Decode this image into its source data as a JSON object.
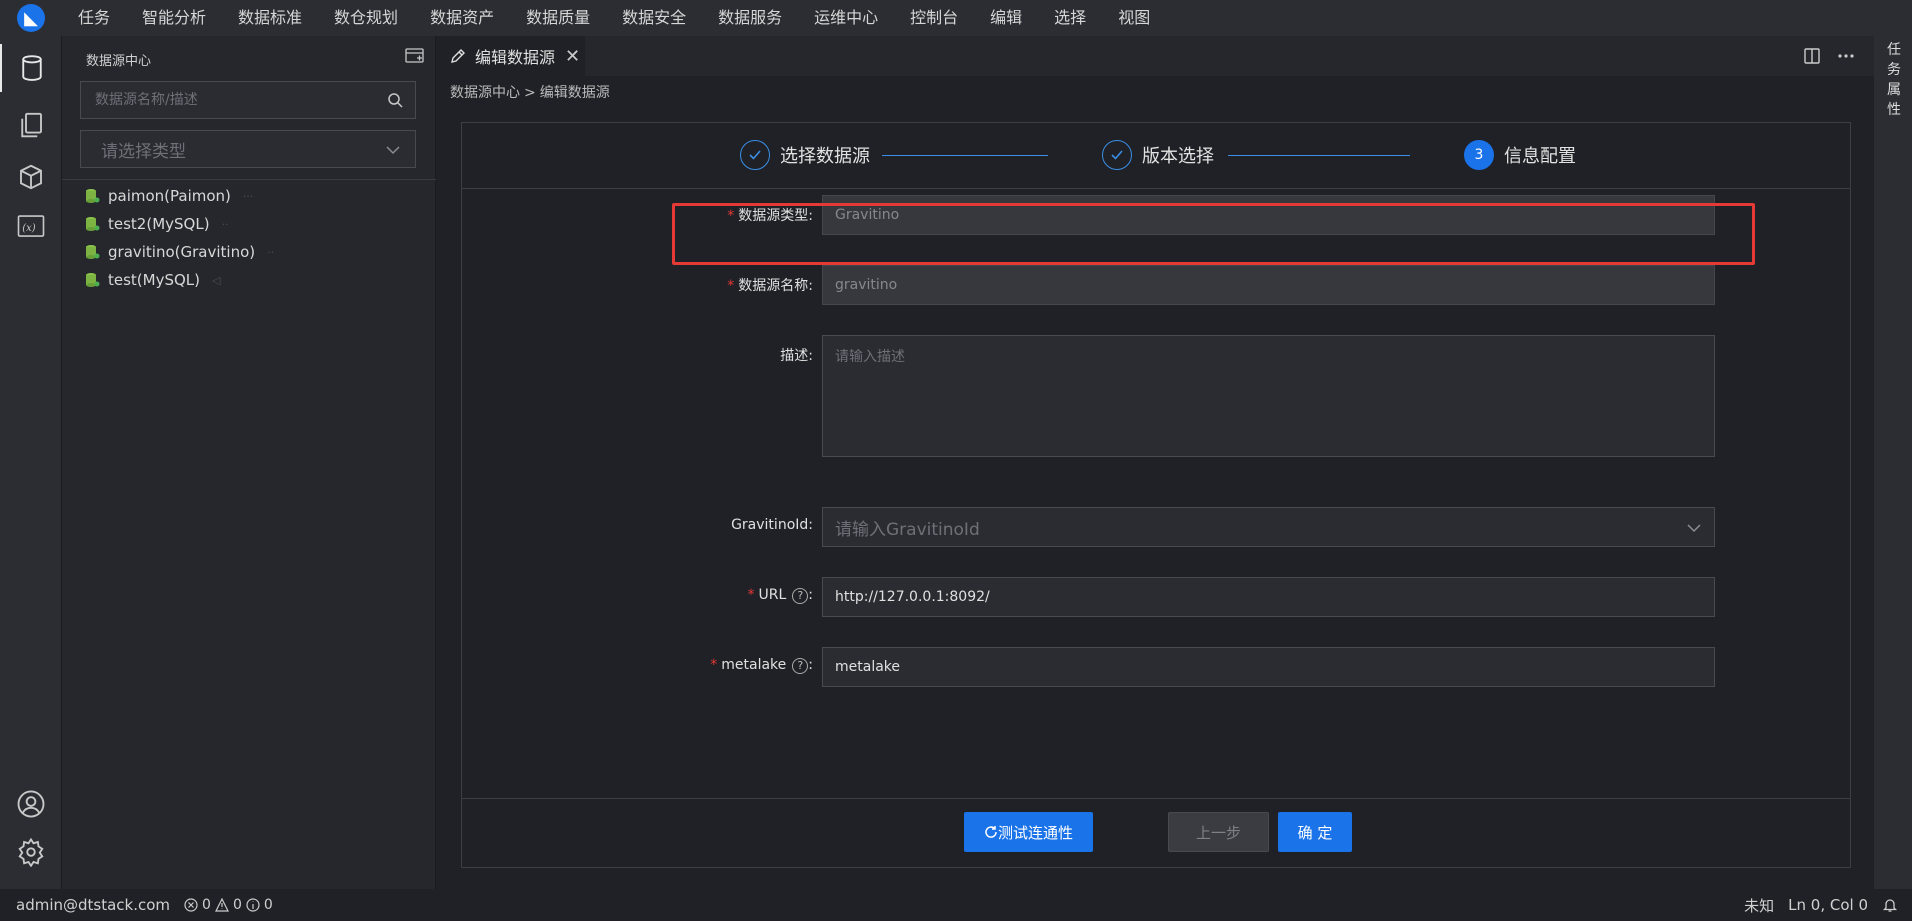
{
  "menubar": {
    "items": [
      "任务",
      "智能分析",
      "数据标准",
      "数仓规划",
      "数据资产",
      "数据质量",
      "数据安全",
      "数据服务",
      "运维中心",
      "控制台",
      "编辑",
      "选择",
      "视图"
    ]
  },
  "sidebar": {
    "title": "数据源中心",
    "search_placeholder": "数据源名称/描述",
    "type_placeholder": "请选择类型",
    "items": [
      {
        "label": "paimon(Paimon)"
      },
      {
        "label": "test2(MySQL)"
      },
      {
        "label": "gravitino(Gravitino)"
      },
      {
        "label": "test(MySQL)"
      }
    ]
  },
  "tab": {
    "label": "编辑数据源",
    "close": "✕"
  },
  "right_strip": {
    "label": "任务属性"
  },
  "breadcrumb": {
    "root": "数据源中心",
    "sep": ">",
    "current": "编辑数据源"
  },
  "steps": [
    {
      "label": "选择数据源",
      "state": "done"
    },
    {
      "label": "版本选择",
      "state": "done"
    },
    {
      "label": "信息配置",
      "state": "active",
      "number": "3"
    }
  ],
  "form": {
    "type_label": "数据源类型",
    "type_value": "Gravitino",
    "name_label": "数据源名称",
    "name_value": "gravitino",
    "desc_label": "描述",
    "desc_placeholder": "请输入描述",
    "gid_label": "GravitinoId",
    "gid_placeholder": "请输入GravitinoId",
    "url_label": "URL",
    "url_value": "http://127.0.0.1:8092/",
    "metalake_label": "metalake",
    "metalake_value": "metalake",
    "colon": ":",
    "required_mark": "*",
    "help_mark": "?"
  },
  "buttons": {
    "test": "测试连通性",
    "prev": "上一步",
    "confirm": "确 定"
  },
  "statusbar": {
    "user": "admin@dtstack.com",
    "errors": "0",
    "warnings": "0",
    "infos": "0",
    "lang": "未知",
    "position": "Ln 0, Col 0"
  },
  "colors": {
    "accent": "#1a73e8",
    "highlight": "#e53935"
  }
}
